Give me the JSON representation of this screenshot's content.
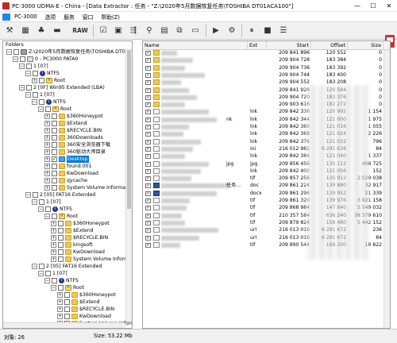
{
  "window": {
    "title": "PC-3000 UDMA-E - China - [Data Extractor : 任务 - \"Z:\\2020年5月数据恢复任务\\TOSHIBA DT01ACA100\"]",
    "min": "—",
    "max": "☐",
    "close": "✕"
  },
  "menu": {
    "items": [
      "PC-3000",
      "选项",
      "服务",
      "窗口",
      "帮助(Z)"
    ]
  },
  "toolbar": {
    "raw_label": "RAW"
  },
  "tree": {
    "label": "Folders",
    "nodes": [
      {
        "label": "Z:\\2020年5月数据恢复任务\\TOSHIBA DT01ACA10",
        "indent": 0,
        "exp": "−",
        "chk": "",
        "icon": "disk"
      },
      {
        "label": "0 - PC3000 PATA0",
        "indent": 1,
        "exp": "−",
        "chk": "",
        "icon": "drive"
      },
      {
        "label": "1 [07]",
        "indent": 2,
        "exp": "−",
        "chk": "",
        "icon": ""
      },
      {
        "label": "NTFS",
        "indent": 3,
        "exp": "−",
        "chk": "",
        "icon": "info"
      },
      {
        "label": "Root",
        "indent": 4,
        "exp": "+",
        "chk": "",
        "icon": "root"
      },
      {
        "label": "2 [0F] Win95 Extended  (LBA)",
        "indent": 2,
        "exp": "−",
        "chk": "",
        "icon": ""
      },
      {
        "label": "1 [07]",
        "indent": 3,
        "exp": "−",
        "chk": "",
        "icon": ""
      },
      {
        "label": "NTFS",
        "indent": 4,
        "exp": "−",
        "chk": "",
        "icon": "info"
      },
      {
        "label": "Root",
        "indent": 5,
        "exp": "−",
        "chk": "",
        "icon": "root"
      },
      {
        "label": "$360Honeypot",
        "indent": 6,
        "exp": "+",
        "chk": "",
        "icon": "folder"
      },
      {
        "label": "$Extend",
        "indent": 6,
        "exp": "+",
        "chk": "",
        "icon": "folder"
      },
      {
        "label": "$RECYCLE.BIN",
        "indent": 6,
        "exp": "+",
        "chk": "",
        "icon": "folder"
      },
      {
        "label": "360Downloads",
        "indent": 6,
        "exp": "+",
        "chk": "",
        "icon": "folder"
      },
      {
        "label": "360安全浏览器下载",
        "indent": 6,
        "exp": "+",
        "chk": "",
        "icon": "folder"
      },
      {
        "label": "360驱动大师目录",
        "indent": 6,
        "exp": "+",
        "chk": "",
        "icon": "folder"
      },
      {
        "label": "Desktop",
        "indent": 6,
        "exp": "+",
        "chk": "✓",
        "icon": "desk",
        "selected": true
      },
      {
        "label": "found.001",
        "indent": 6,
        "exp": "+",
        "chk": "",
        "icon": "folder"
      },
      {
        "label": "KwDownload",
        "indent": 6,
        "exp": "+",
        "chk": "",
        "icon": "folder"
      },
      {
        "label": "qycache",
        "indent": 6,
        "exp": "+",
        "chk": "",
        "icon": "folder"
      },
      {
        "label": "System Volume Information",
        "indent": 6,
        "exp": "+",
        "chk": "",
        "icon": "folder"
      },
      {
        "label": "2 [05] FAT16 Extended",
        "indent": 3,
        "exp": "−",
        "chk": "",
        "icon": ""
      },
      {
        "label": "1 [07]",
        "indent": 4,
        "exp": "−",
        "chk": "",
        "icon": ""
      },
      {
        "label": "NTFS",
        "indent": 5,
        "exp": "−",
        "chk": "",
        "icon": "info"
      },
      {
        "label": "Root",
        "indent": 6,
        "exp": "−",
        "chk": "",
        "icon": "root"
      },
      {
        "label": "$360Honeypot",
        "indent": 7,
        "exp": "+",
        "chk": "",
        "icon": "folder"
      },
      {
        "label": "$Extend",
        "indent": 7,
        "exp": "+",
        "chk": "",
        "icon": "folder"
      },
      {
        "label": "$RECYCLE.BIN",
        "indent": 7,
        "exp": "+",
        "chk": "",
        "icon": "folder"
      },
      {
        "label": "kingsoft",
        "indent": 7,
        "exp": "+",
        "chk": "",
        "icon": "folder"
      },
      {
        "label": "KwDownload",
        "indent": 7,
        "exp": "+",
        "chk": "",
        "icon": "folder"
      },
      {
        "label": "System Volume Information",
        "indent": 7,
        "exp": "+",
        "chk": "",
        "icon": "folder"
      },
      {
        "label": "2 [05] FAT16 Extended",
        "indent": 4,
        "exp": "−",
        "chk": "",
        "icon": ""
      },
      {
        "label": "1 [07]",
        "indent": 5,
        "exp": "−",
        "chk": "",
        "icon": ""
      },
      {
        "label": "NTFS",
        "indent": 6,
        "exp": "−",
        "chk": "",
        "icon": "info"
      },
      {
        "label": "Root",
        "indent": 7,
        "exp": "−",
        "chk": "",
        "icon": "root"
      },
      {
        "label": "$360Honeypot",
        "indent": 8,
        "exp": "+",
        "chk": "",
        "icon": "folder"
      },
      {
        "label": "$Extend",
        "indent": 8,
        "exp": "+",
        "chk": "",
        "icon": "folder"
      },
      {
        "label": "$RECYCLE.BIN",
        "indent": 8,
        "exp": "+",
        "chk": "",
        "icon": "folder"
      },
      {
        "label": "KwDownload",
        "indent": 8,
        "exp": "+",
        "chk": "",
        "icon": "folder"
      },
      {
        "label": "System Volume Information",
        "indent": 8,
        "exp": "+",
        "chk": "",
        "icon": "folder"
      }
    ]
  },
  "files": {
    "columns": [
      "Name",
      "Ext",
      "Start",
      "Offset",
      "Size"
    ],
    "rows": [
      {
        "name": "",
        "ext": "",
        "start": "209 841 896",
        "offset": "120 552",
        "size": "0",
        "icon": "folder",
        "chk": "✓"
      },
      {
        "name": "",
        "ext": "",
        "start": "209 904 728",
        "offset": "183 384",
        "size": "0",
        "icon": "folder",
        "chk": "✓"
      },
      {
        "name": "",
        "ext": "",
        "start": "209 904 736",
        "offset": "183 392",
        "size": "0",
        "icon": "folder",
        "chk": "✓"
      },
      {
        "name": "",
        "ext": "",
        "start": "209 904 744",
        "offset": "183 400",
        "size": "0",
        "icon": "folder",
        "chk": "✓"
      },
      {
        "name": "",
        "ext": "",
        "start": "209 904 552",
        "offset": "183 208",
        "size": "0",
        "icon": "folder",
        "chk": "✓"
      },
      {
        "name": "",
        "ext": "",
        "start": "209 841 928",
        "offset": "120 584",
        "size": "0",
        "icon": "folder",
        "chk": "✓"
      },
      {
        "name": "",
        "ext": "",
        "start": "209 904 720",
        "offset": "183 376",
        "size": "0",
        "icon": "folder",
        "chk": "✓"
      },
      {
        "name": "",
        "ext": "",
        "start": "209 903 616",
        "offset": "182 272",
        "size": "0",
        "icon": "folder",
        "chk": "✓"
      },
      {
        "name": "",
        "ext": "lnk",
        "start": "209 842 336",
        "offset": "120 992",
        "size": "1 154",
        "icon": "file",
        "chk": "✓"
      },
      {
        "name": "nk",
        "ext": "lnk",
        "start": "209 842 344",
        "offset": "121 000",
        "size": "1 975",
        "icon": "file",
        "chk": "✓"
      },
      {
        "name": "",
        "ext": "lnk",
        "start": "209 842 360",
        "offset": "121 016",
        "size": "1 055",
        "icon": "file",
        "chk": "✓"
      },
      {
        "name": "",
        "ext": "lnk",
        "start": "209 842 368",
        "offset": "121 024",
        "size": "2 226",
        "icon": "file",
        "chk": "✓"
      },
      {
        "name": "",
        "ext": "lnk",
        "start": "209 842 376",
        "offset": "121 032",
        "size": "796",
        "icon": "file",
        "chk": "✓"
      },
      {
        "name": "",
        "ext": "ini",
        "start": "216 012 982",
        "offset": "6 291 638",
        "size": "84",
        "icon": "file",
        "chk": "✓"
      },
      {
        "name": "",
        "ext": "lnk",
        "start": "209 842 384",
        "offset": "121 040",
        "size": "1 337",
        "icon": "file",
        "chk": "✓"
      },
      {
        "name": "jpg",
        "ext": "jpg",
        "start": "209 856 456",
        "offset": "135 112",
        "size": "408 725",
        "icon": "file",
        "chk": "✓"
      },
      {
        "name": "",
        "ext": "lnk",
        "start": "209 842 400",
        "offset": "121 056",
        "size": "152",
        "icon": "file",
        "chk": "✓"
      },
      {
        "name": "",
        "ext": "tif",
        "start": "209 857 256",
        "offset": "135 912",
        "size": "2 029 038",
        "icon": "file",
        "chk": "✓"
      },
      {
        "name": "任务…",
        "ext": "doc",
        "start": "209 861 224",
        "offset": "139 880",
        "size": "32 917",
        "icon": "doc",
        "chk": "✓"
      },
      {
        "name": "",
        "ext": "docx",
        "start": "209 861 296",
        "offset": "139 952",
        "size": "21 339",
        "icon": "doc",
        "chk": "✓"
      },
      {
        "name": "",
        "ext": "tif",
        "start": "209 861 320",
        "offset": "139 976",
        "size": "3 921 158",
        "icon": "file",
        "chk": "✓"
      },
      {
        "name": "",
        "ext": "tif",
        "start": "209 868 984",
        "offset": "147 640",
        "size": "5 549 032",
        "icon": "file",
        "chk": "✓"
      },
      {
        "name": "",
        "ext": "tif",
        "start": "210 357 584",
        "offset": "636 240",
        "size": "38 379 610",
        "icon": "file",
        "chk": "✓"
      },
      {
        "name": "",
        "ext": "tif",
        "start": "209 879 824",
        "offset": "158 480",
        "size": "5 442 152",
        "icon": "file",
        "chk": "✓"
      },
      {
        "name": "",
        "ext": "url",
        "start": "216 013 016",
        "offset": "6 291 672",
        "size": "236",
        "icon": "file",
        "chk": "✓"
      },
      {
        "name": "",
        "ext": "url",
        "start": "216 013 016",
        "offset": "6 291 672",
        "size": "84",
        "icon": "file",
        "chk": "✓"
      },
      {
        "name": "",
        "ext": "tif",
        "start": "209 890 544",
        "offset": "169 200",
        "size": "18 622",
        "icon": "file",
        "chk": "✓"
      }
    ]
  },
  "status": {
    "count": "对象: 26",
    "size": "Size: 53.22 Mb"
  },
  "colors": {
    "selection": "#0078d7",
    "folder": "#f2c94c"
  }
}
